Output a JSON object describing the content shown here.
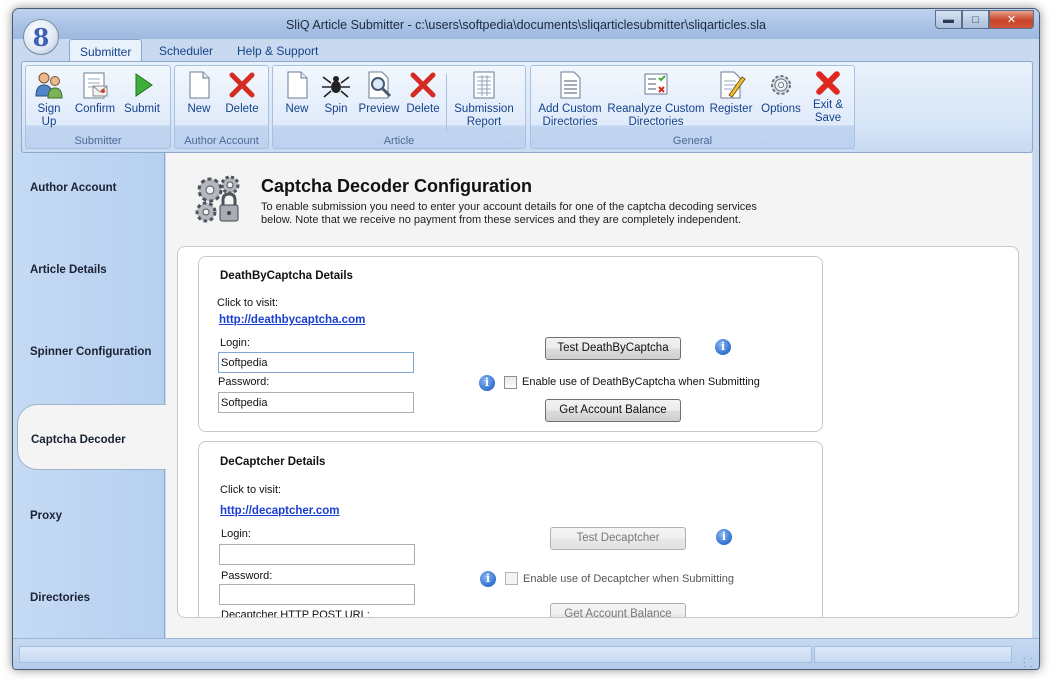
{
  "window": {
    "title": "SliQ Article Submitter - c:\\users\\softpedia\\documents\\sliqarticlesubmitter\\sliqarticles.sla"
  },
  "app_icon_glyph": "8",
  "ribbon_tabs": [
    "Submitter",
    "Scheduler",
    "Help & Support"
  ],
  "ribbon": {
    "submitter": {
      "label": "Submitter",
      "sign_up": [
        "Sign",
        "Up"
      ],
      "confirm": "Confirm",
      "submit": "Submit"
    },
    "author_account": {
      "label": "Author Account",
      "new": "New",
      "delete": "Delete"
    },
    "article": {
      "label": "Article",
      "new": "New",
      "spin": "Spin",
      "preview": "Preview",
      "delete": "Delete",
      "submission_report": [
        "Submission",
        "Report"
      ]
    },
    "general": {
      "label": "General",
      "add_custom": [
        "Add Custom",
        "Directories"
      ],
      "reanalyze": [
        "Reanalyze Custom",
        "Directories"
      ],
      "register": "Register",
      "options": "Options",
      "exit_save": [
        "Exit &",
        "Save"
      ]
    }
  },
  "sidebar": [
    "Author Account",
    "Article Details",
    "Spinner Configuration",
    "Captcha Decoder",
    "Proxy",
    "Directories"
  ],
  "page": {
    "title": "Captcha Decoder Configuration",
    "description": "To enable submission you need to enter your account details for one of the captcha decoding services below. Note that we receive no payment from these services and they are completely independent."
  },
  "dbc": {
    "title": "DeathByCaptcha Details",
    "click_to_visit": "Click to visit:",
    "link": "http://deathbycaptcha.com",
    "login_label": "Login:",
    "login_value": "Softpedia",
    "password_label": "Password:",
    "password_value": "Softpedia",
    "test_button": "Test DeathByCaptcha",
    "enable_label": "Enable use of DeathByCaptcha when Submitting",
    "balance_button": "Get Account Balance"
  },
  "dec": {
    "title": "DeCaptcher Details",
    "click_to_visit": "Click to visit:",
    "link": "http://decaptcher.com",
    "login_label": "Login:",
    "login_value": "",
    "password_label": "Password:",
    "password_value": "",
    "test_button": "Test Decaptcher",
    "enable_label": "Enable use of Decaptcher when Submitting",
    "balance_button": "Get Account Balance",
    "http_post_label": "Decaptcher HTTP POST URL:"
  },
  "colors": {
    "ribbon_text": "#15428b",
    "link": "#1a3fcf",
    "info": "#2f6fd0"
  },
  "icons": [
    "sign-up-icon",
    "confirm-icon",
    "submit-icon",
    "new-icon",
    "delete-icon",
    "spin-icon",
    "preview-icon",
    "submission-report-icon",
    "add-custom-directories-icon",
    "reanalyze-icon",
    "register-icon",
    "options-icon",
    "exit-save-icon",
    "gears-lock-icon",
    "info-icon"
  ]
}
